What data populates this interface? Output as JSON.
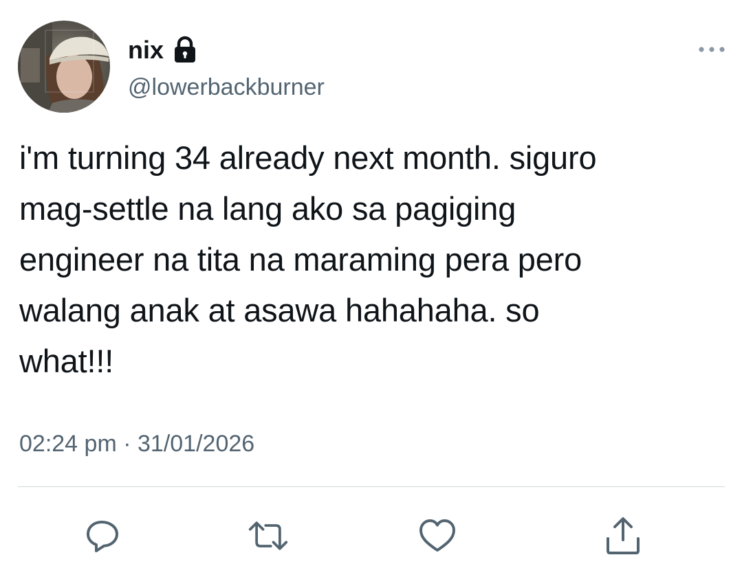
{
  "author": {
    "display_name": "nix",
    "handle": "@lowerbackburner",
    "avatar_icon": "profile-photo",
    "protected_icon": "lock-icon"
  },
  "tweet": {
    "text": "i'm turning 34 already next month. siguro\nmag-settle na lang ako sa pagiging\nengineer na tita na maraming pera pero\nwalang anak at asawa hahahaha. so\nwhat!!!",
    "time": "02:24 pm",
    "separator": "·",
    "date": "31/01/2026"
  },
  "actions": {
    "reply_icon": "reply-icon",
    "retweet_icon": "retweet-icon",
    "like_icon": "heart-icon",
    "share_icon": "share-icon",
    "more_icon": "more-icon"
  },
  "colors": {
    "text": "#0f1419",
    "secondary": "#536471",
    "icon": "#536471",
    "divider": "#cfd9de"
  }
}
